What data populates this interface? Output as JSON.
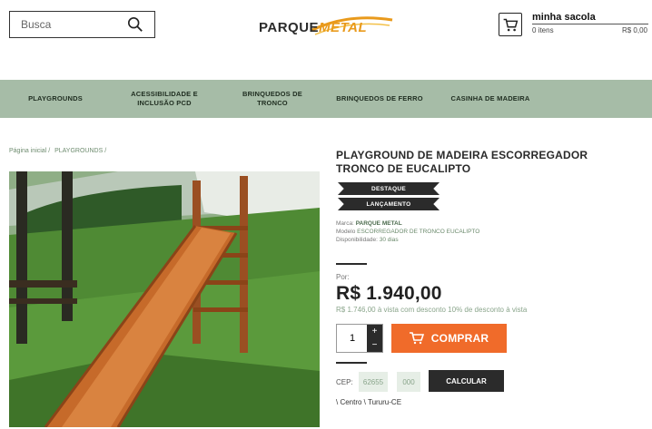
{
  "header": {
    "search": {
      "placeholder": "Busca"
    },
    "logo": {
      "part1": "PARQUE",
      "part2": "METAL"
    },
    "cart": {
      "title": "minha sacola",
      "items": "0 itens",
      "total": "R$ 0,00"
    }
  },
  "nav": {
    "items": [
      {
        "label": "PLAYGROUNDS"
      },
      {
        "label": "ACESSIBILIDADE E\nINCLUSÃO PCD"
      },
      {
        "label": "BRINQUEDOS DE\nTRONCO"
      },
      {
        "label": "BRINQUEDOS DE FERRO"
      },
      {
        "label": "CASINHA DE MADEIRA"
      }
    ]
  },
  "breadcrumb": {
    "home": "Página inicial /",
    "category": "PLAYGROUNDS /"
  },
  "product": {
    "title": "PLAYGROUND DE MADEIRA ESCORREGADOR TRONCO DE EUCALIPTO",
    "badges": [
      "DESTAQUE",
      "LANÇAMENTO"
    ],
    "brand_label": "Marca:",
    "brand": "PARQUE METAL",
    "model_label": "Modelo",
    "model": "ESCORREGADOR DE TRONCO EUCALIPTO",
    "availability_label": "Disponibilidade:",
    "availability": "30 dias",
    "price_prefix": "Por:",
    "price": "R$ 1.940,00",
    "discount_text": "R$ 1.746,00 à vista com desconto 10% de desconto à vista",
    "quantity": "1",
    "buy_label": "COMPRAR"
  },
  "shipping": {
    "cep_label": "CEP:",
    "cep_part1": "62655",
    "cep_part2": "000",
    "calc_label": "CALCULAR",
    "location": "\\ Centro \\ Tururu-CE"
  },
  "colors": {
    "nav_bg": "#a6bca7",
    "buy_button": "#f06b2a",
    "dark": "#2b2b2b",
    "logo_accent": "#e99a1c"
  },
  "icons": {
    "search": "search-icon",
    "cart": "cart-icon",
    "buy": "cart-icon",
    "plus": "plus-icon",
    "minus": "minus-icon"
  }
}
